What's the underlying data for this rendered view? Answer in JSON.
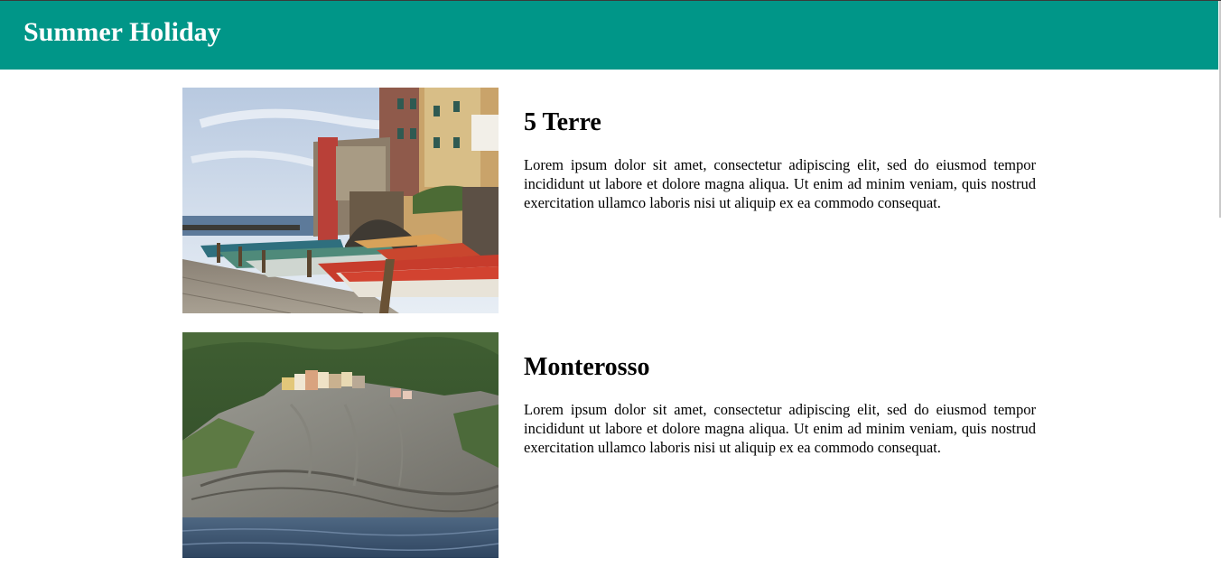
{
  "header": {
    "title": "Summer Holiday",
    "background": "#009688"
  },
  "articles": [
    {
      "title": "5 Terre",
      "body": "Lorem ipsum dolor sit amet, consectetur adipiscing elit, sed do eiusmod tempor incididunt ut labore et dolore magna aliqua. Ut enim ad minim veniam, quis nostrud exercitation ullamco laboris nisi ut aliquip ex ea commodo consequat.",
      "image": "harbor-boats-photo"
    },
    {
      "title": "Monterosso",
      "body": "Lorem ipsum dolor sit amet, consectetur adipiscing elit, sed do eiusmod tempor incididunt ut labore et dolore magna aliqua. Ut enim ad minim veniam, quis nostrud exercitation ullamco laboris nisi ut aliquip ex ea commodo consequat.",
      "image": "cliff-village-photo"
    }
  ]
}
